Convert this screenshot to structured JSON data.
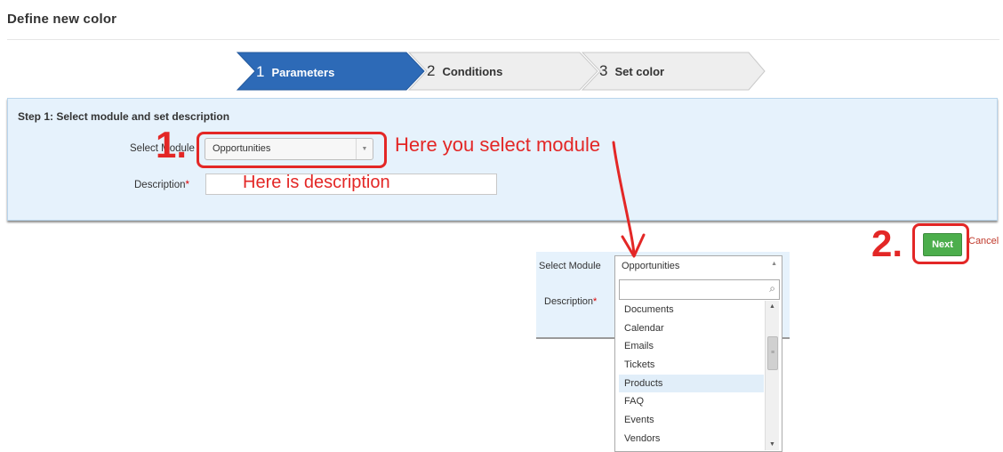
{
  "page": {
    "title": "Define new color"
  },
  "wizard": {
    "steps": [
      {
        "num": "1",
        "label": "Parameters",
        "active": true
      },
      {
        "num": "2",
        "label": "Conditions",
        "active": false
      },
      {
        "num": "3",
        "label": "Set color",
        "active": false
      }
    ],
    "active_color": "#2d6ab7",
    "inactive_color": "#eeeeee"
  },
  "form": {
    "heading": "Step 1: Select module and set description",
    "module_label": "Select Module",
    "module_value": "Opportunities",
    "description_label": "Description",
    "required_mark": "*",
    "description_value": ""
  },
  "annotations": {
    "marker_1": "1.",
    "marker_2": "2.",
    "select_hint": "Here you select module",
    "description_hint": "Here is description",
    "color": "#e32726"
  },
  "actions": {
    "next_label": "Next",
    "cancel_label": "Cancel",
    "next_color": "#4cae4c"
  },
  "dropdown_preview": {
    "module_label": "Select Module",
    "module_value": "Opportunities",
    "description_label": "Description",
    "required_mark": "*",
    "search_placeholder": "",
    "options": [
      "Documents",
      "Calendar",
      "Emails",
      "Tickets",
      "Products",
      "FAQ",
      "Events",
      "Vendors"
    ],
    "highlighted": "Products"
  },
  "icons": [
    "chevron-down-icon",
    "chevron-up-icon",
    "search-icon",
    "scroll-up-icon",
    "scroll-down-icon"
  ]
}
